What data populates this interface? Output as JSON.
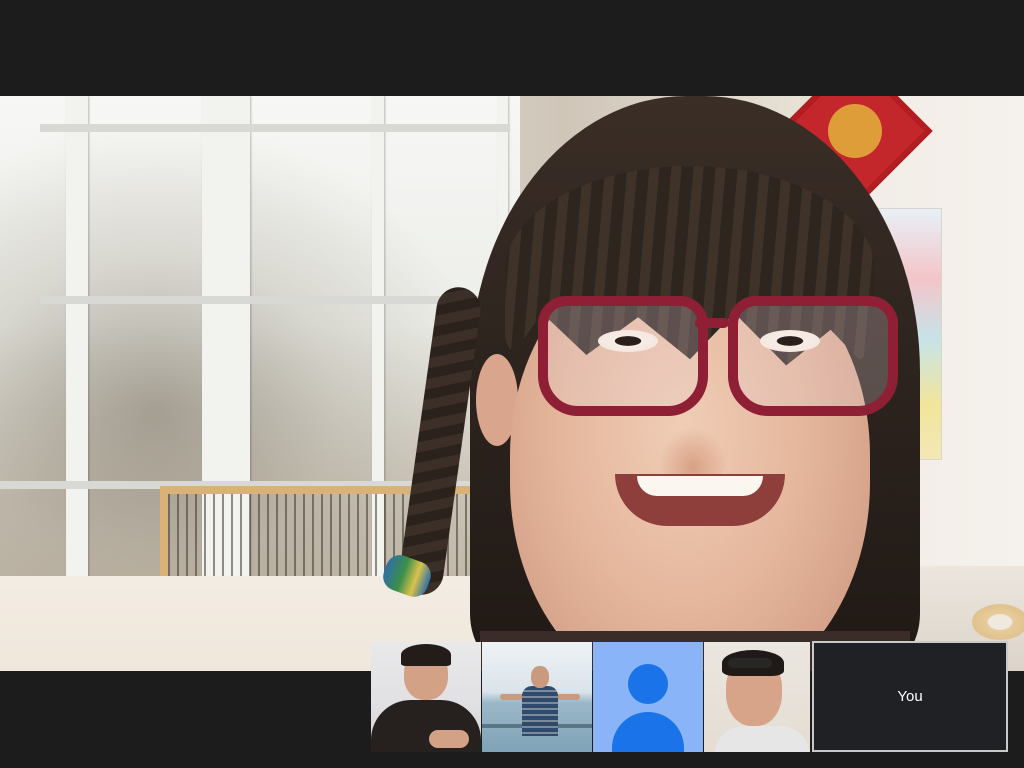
{
  "meeting": {
    "main_speaker": {
      "description_icon": "participant-video"
    },
    "thumbnails": [
      {
        "name_label": "",
        "icon": "participant-video"
      },
      {
        "name_label": "",
        "icon": "participant-video"
      },
      {
        "name_label": "",
        "icon": "avatar-icon"
      },
      {
        "name_label": "",
        "icon": "participant-video"
      }
    ],
    "self_view": {
      "label": "You"
    }
  },
  "colors": {
    "background": "#1c1c1c",
    "avatar_tile": "#8ab4f8",
    "avatar_icon": "#1a73e8",
    "self_tile": "#202124",
    "self_border": "#c9c9c9"
  }
}
